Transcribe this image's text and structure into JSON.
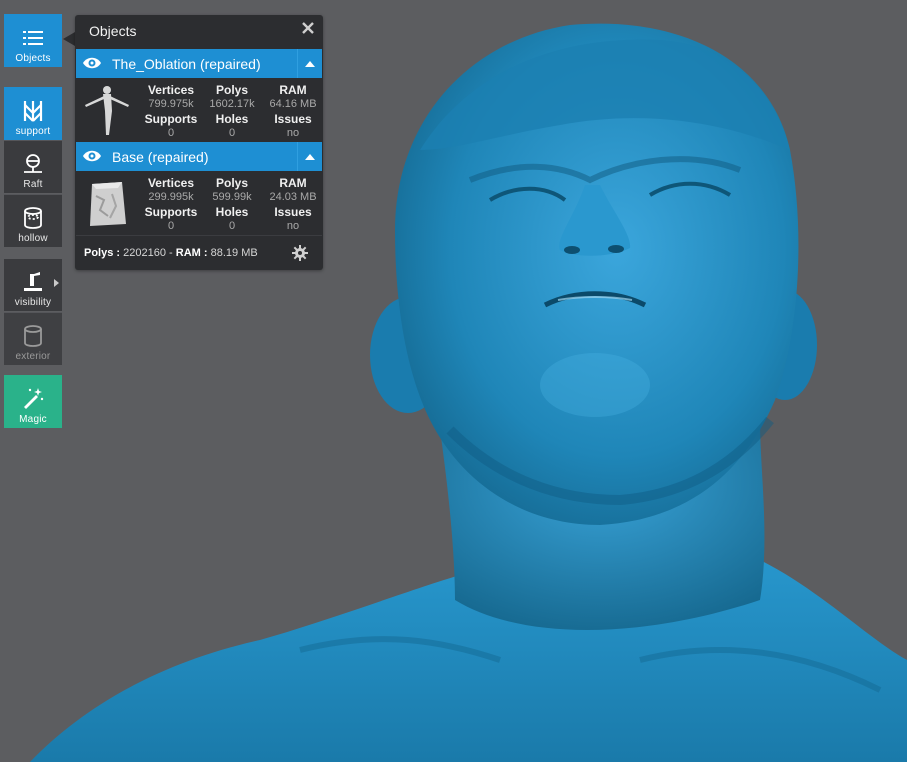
{
  "toolbar": {
    "objects": "Objects",
    "support": "support",
    "raft": "Raft",
    "hollow": "hollow",
    "visibility": "visibility",
    "exterior": "exterior",
    "magic": "Magic"
  },
  "panel": {
    "title": "Objects",
    "objects": [
      {
        "name": "The_Oblation (repaired)",
        "stats": [
          {
            "label": "Vertices",
            "value": "799.975k"
          },
          {
            "label": "Polys",
            "value": "1602.17k"
          },
          {
            "label": "RAM",
            "value": "64.16 MB"
          },
          {
            "label": "Supports",
            "value": "0"
          },
          {
            "label": "Holes",
            "value": "0"
          },
          {
            "label": "Issues",
            "value": "no"
          }
        ]
      },
      {
        "name": "Base (repaired)",
        "stats": [
          {
            "label": "Vertices",
            "value": "299.995k"
          },
          {
            "label": "Polys",
            "value": "599.99k"
          },
          {
            "label": "RAM",
            "value": "24.03 MB"
          },
          {
            "label": "Supports",
            "value": "0"
          },
          {
            "label": "Holes",
            "value": "0"
          },
          {
            "label": "Issues",
            "value": "no"
          }
        ]
      }
    ],
    "footer": {
      "polys_label": "Polys :",
      "polys_value": "2202160",
      "sep": "-",
      "ram_label": "RAM :",
      "ram_value": "88.19 MB"
    }
  },
  "colors": {
    "accent": "#1e8fd3",
    "magic": "#2ab28a",
    "model": "#1f86b8",
    "background": "#5c5d60"
  }
}
